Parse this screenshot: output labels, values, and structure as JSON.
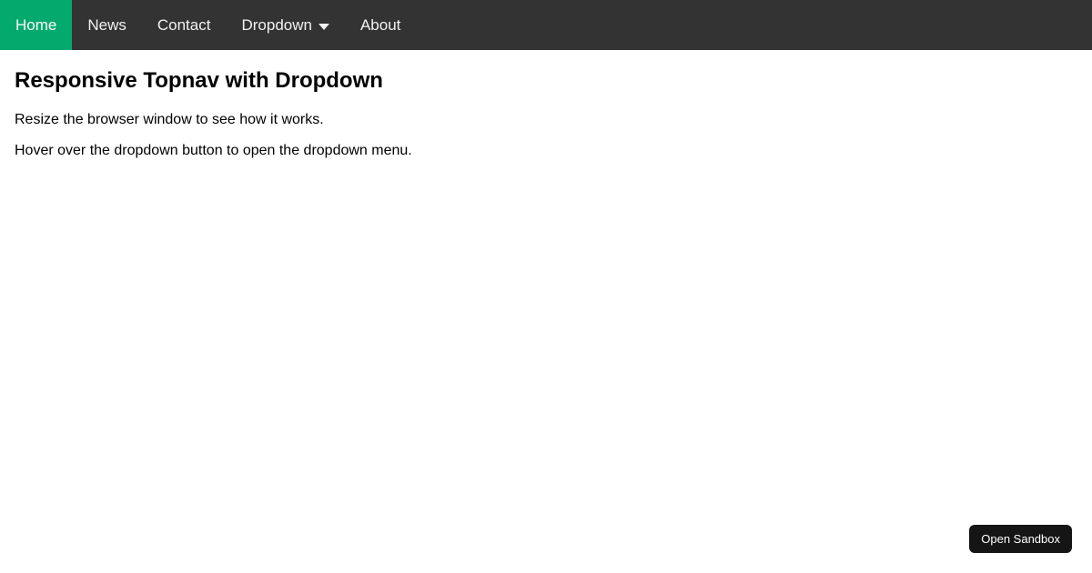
{
  "nav": {
    "items": [
      {
        "label": "Home",
        "active": true
      },
      {
        "label": "News",
        "active": false
      },
      {
        "label": "Contact",
        "active": false
      },
      {
        "label": "Dropdown",
        "active": false,
        "has_caret": true
      },
      {
        "label": "About",
        "active": false
      }
    ],
    "colors": {
      "background": "#333333",
      "active_background": "#04AA6D",
      "text": "#f2f2f2",
      "active_text": "#ffffff"
    }
  },
  "main": {
    "title": "Responsive Topnav with Dropdown",
    "paragraphs": [
      "Resize the browser window to see how it works.",
      "Hover over the dropdown button to open the dropdown menu."
    ]
  },
  "sandbox_button": {
    "label": "Open Sandbox",
    "background": "#151515",
    "text_color": "#ffffff"
  },
  "icons": {
    "dropdown_caret": "caret-down-icon"
  }
}
